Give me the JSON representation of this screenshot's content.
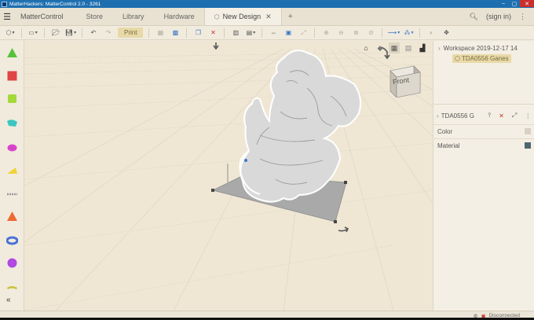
{
  "window": {
    "title": "MatterHackers: MatterControl 2.0 - 3261"
  },
  "header": {
    "app_tab": "MatterControl",
    "tabs": [
      {
        "label": "Store"
      },
      {
        "label": "Library"
      },
      {
        "label": "Hardware"
      },
      {
        "label": "New Design",
        "active": true
      }
    ],
    "sign_in": "(sign in)"
  },
  "toolbar": {
    "print_label": "Print"
  },
  "viewport": {
    "view_cube_face": "Front",
    "shapes_palette": [
      "cone",
      "cube",
      "cylinder",
      "wedge",
      "half-sphere",
      "triangle-wedge",
      "text",
      "pyramid",
      "torus",
      "sphere",
      "image"
    ]
  },
  "sidepanel": {
    "workspace_label": "Workspace 2019-12-17 14",
    "workspace_item": "TDA0556 Ganes",
    "object_label": "TDA0556 G",
    "properties": [
      {
        "label": "Color",
        "color": "#d8d2c4"
      },
      {
        "label": "Material",
        "color": "#4e6670"
      }
    ]
  },
  "status": {
    "connection": "Disconnected"
  },
  "colors": {
    "accent": "#e8d9a8",
    "titlebar": "#1e6fb0",
    "bed": "#a9a9a9",
    "model": "#d9d9d9"
  }
}
